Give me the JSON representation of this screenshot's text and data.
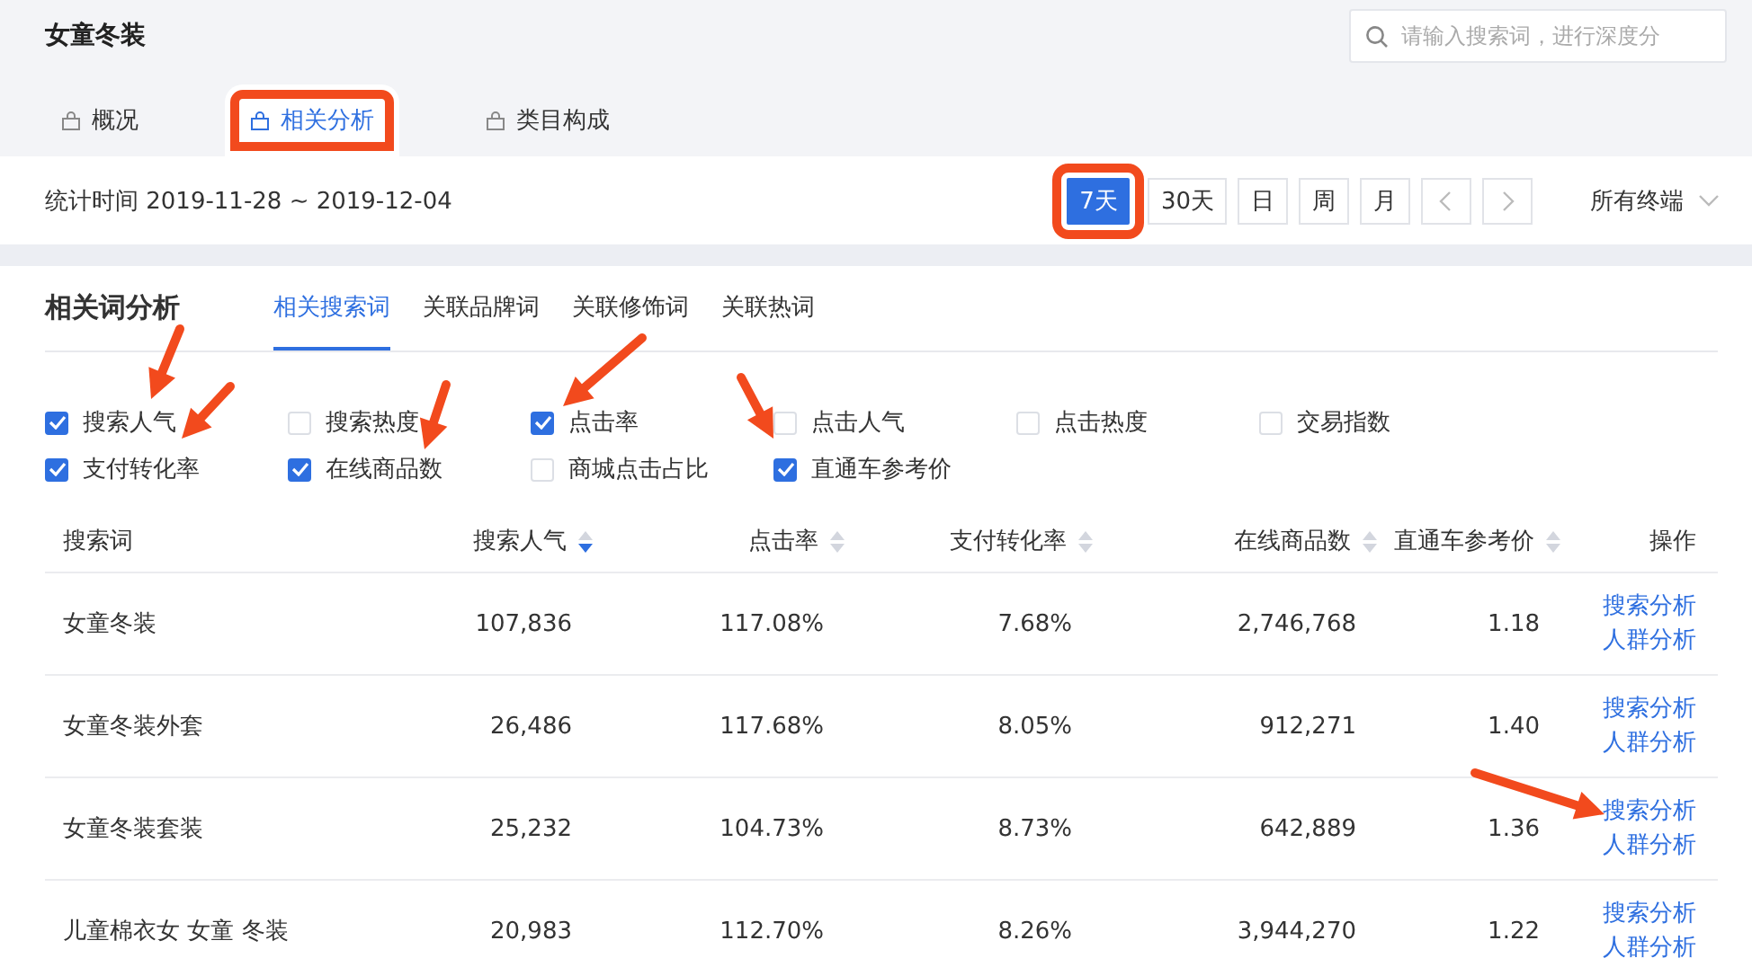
{
  "page_title": "女童冬装",
  "search": {
    "placeholder": "请输入搜索词，进行深度分"
  },
  "tabs": [
    {
      "label": "概况",
      "selected": false,
      "highlighted": false
    },
    {
      "label": "相关分析",
      "selected": true,
      "highlighted": true
    },
    {
      "label": "类目构成",
      "selected": false,
      "highlighted": false
    }
  ],
  "date_range": "统计时间 2019-11-28 ~ 2019-12-04",
  "period_buttons": [
    {
      "label": "7天",
      "selected": true,
      "highlighted": true
    },
    {
      "label": "30天",
      "selected": false,
      "highlighted": false
    },
    {
      "label": "日",
      "selected": false,
      "highlighted": false
    },
    {
      "label": "周",
      "selected": false,
      "highlighted": false
    },
    {
      "label": "月",
      "selected": false,
      "highlighted": false
    }
  ],
  "terminal_select": "所有终端",
  "section_title": "相关词分析",
  "sub_tabs": [
    {
      "label": "相关搜索词",
      "selected": true
    },
    {
      "label": "关联品牌词",
      "selected": false
    },
    {
      "label": "关联修饰词",
      "selected": false
    },
    {
      "label": "关联热词",
      "selected": false
    }
  ],
  "metrics": [
    {
      "label": "搜索人气",
      "checked": true
    },
    {
      "label": "搜索热度",
      "checked": false
    },
    {
      "label": "点击率",
      "checked": true
    },
    {
      "label": "点击人气",
      "checked": false
    },
    {
      "label": "点击热度",
      "checked": false
    },
    {
      "label": "交易指数",
      "checked": false
    },
    {
      "label": "支付转化率",
      "checked": true
    },
    {
      "label": "在线商品数",
      "checked": true
    },
    {
      "label": "商城点击占比",
      "checked": false
    },
    {
      "label": "直通车参考价",
      "checked": true
    }
  ],
  "table": {
    "columns": [
      {
        "label": "搜索词",
        "kind": "plain"
      },
      {
        "label": "搜索人气",
        "kind": "sortable",
        "sorted_desc": true
      },
      {
        "label": "点击率",
        "kind": "sortable",
        "sorted_desc": false
      },
      {
        "label": "支付转化率",
        "kind": "sortable",
        "sorted_desc": false
      },
      {
        "label": "在线商品数",
        "kind": "sortable",
        "sorted_desc": false
      },
      {
        "label": "直通车参考价",
        "kind": "sortable",
        "sorted_desc": false
      },
      {
        "label": "操作",
        "kind": "plain"
      }
    ],
    "rows": [
      {
        "cells": [
          "女童冬装",
          "107,836",
          "117.08%",
          "7.68%",
          "2,746,768",
          "1.18"
        ],
        "actions": [
          "搜索分析",
          "人群分析"
        ]
      },
      {
        "cells": [
          "女童冬装外套",
          "26,486",
          "117.68%",
          "8.05%",
          "912,271",
          "1.40"
        ],
        "actions": [
          "搜索分析",
          "人群分析"
        ]
      },
      {
        "cells": [
          "女童冬装套装",
          "25,232",
          "104.73%",
          "8.73%",
          "642,889",
          "1.36"
        ],
        "actions": [
          "搜索分析",
          "人群分析"
        ]
      },
      {
        "cells": [
          "儿童棉衣女 女童 冬装",
          "20,983",
          "112.70%",
          "8.26%",
          "3,944,270",
          "1.22"
        ],
        "actions": [
          "搜索分析",
          "人群分析"
        ]
      }
    ]
  }
}
